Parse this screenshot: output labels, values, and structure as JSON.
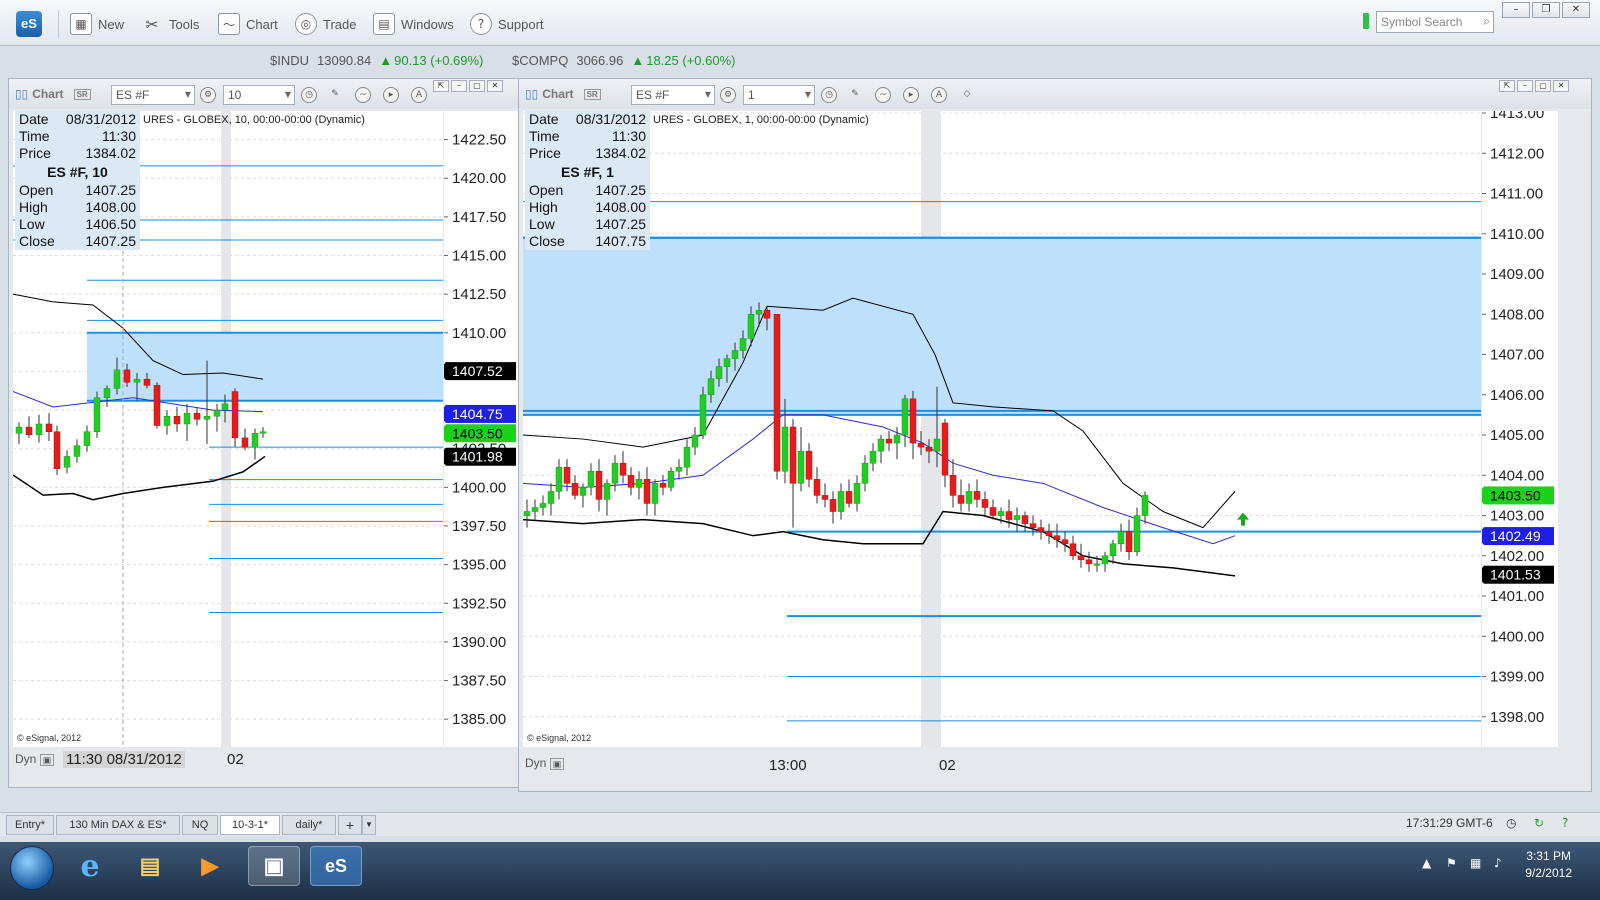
{
  "app": {
    "logo": "eS",
    "toolbar": [
      {
        "label": "New",
        "icon": "new-chart-icon"
      },
      {
        "label": "Tools",
        "icon": "tools-icon"
      },
      {
        "label": "Chart",
        "icon": "chart-icon"
      },
      {
        "label": "Trade",
        "icon": "trade-icon"
      },
      {
        "label": "Windows",
        "icon": "windows-icon"
      },
      {
        "label": "Support",
        "icon": "support-icon"
      }
    ],
    "search_placeholder": "Symbol Search"
  },
  "tickers": [
    {
      "symbol": "$INDU",
      "last": "13090.84",
      "change": "90.13 (+0.69%)"
    },
    {
      "symbol": "$COMPQ",
      "last": "3066.96",
      "change": "18.25 (+0.60%)"
    }
  ],
  "left_chart": {
    "title": "Chart",
    "symbol": "ES #F",
    "interval": "10",
    "legend": "URES - GLOBEX, 10, 00:00-00:00 (Dynamic)",
    "data_window": {
      "date_label": "Date",
      "date": "08/31/2012",
      "time_label": "Time",
      "time": "11:30",
      "price_label": "Price",
      "price": "1384.02",
      "header": "ES #F, 10",
      "open_label": "Open",
      "open": "1407.25",
      "high_label": "High",
      "high": "1408.00",
      "low_label": "Low",
      "low": "1406.50",
      "close_label": "Close",
      "close": "1407.25"
    },
    "axis_ticks": [
      "1422.50",
      "1420.00",
      "1417.50",
      "1415.00",
      "1412.50",
      "1410.00",
      "1407.50",
      "1405.00",
      "1402.50",
      "1400.00",
      "1397.50",
      "1395.00",
      "1392.50",
      "1390.00",
      "1387.50",
      "1385.00"
    ],
    "price_tags": [
      {
        "label": "1407.52",
        "color": "#000000"
      },
      {
        "label": "1404.75",
        "color": "#1e1ee6"
      },
      {
        "label": "1403.50",
        "color": "#19d219"
      },
      {
        "label": "1401.98",
        "color": "#000000"
      }
    ],
    "dyn": "Dyn",
    "cursor_time": "11:30 08/31/2012",
    "time_tick": "02",
    "copyright": "© eSignal, 2012"
  },
  "right_chart": {
    "title": "Chart",
    "symbol": "ES #F",
    "interval": "1",
    "legend": "URES - GLOBEX, 1, 00:00-00:00 (Dynamic)",
    "data_window": {
      "date_label": "Date",
      "date": "08/31/2012",
      "time_label": "Time",
      "time": "11:30",
      "price_label": "Price",
      "price": "1384.02",
      "header": "ES #F, 1",
      "open_label": "Open",
      "open": "1407.25",
      "high_label": "High",
      "high": "1408.00",
      "low_label": "Low",
      "low": "1407.25",
      "close_label": "Close",
      "close": "1407.75"
    },
    "axis_ticks": [
      "1413.00",
      "1412.00",
      "1411.00",
      "1410.00",
      "1409.00",
      "1408.00",
      "1407.00",
      "1406.00",
      "1405.00",
      "1404.00",
      "1403.00",
      "1402.00",
      "1401.00",
      "1400.00",
      "1399.00",
      "1398.00"
    ],
    "price_tags": [
      {
        "label": "1403.50",
        "color": "#19d219"
      },
      {
        "label": "1402.49",
        "color": "#1e1ee6"
      },
      {
        "label": "1401.53",
        "color": "#000000"
      }
    ],
    "dyn": "Dyn",
    "time_ticks": [
      "13:00",
      "02"
    ],
    "copyright": "© eSignal, 2012"
  },
  "page_tabs": [
    {
      "label": "Entry*",
      "active": false
    },
    {
      "label": "130 Min DAX & ES*",
      "active": false
    },
    {
      "label": "NQ",
      "active": false
    },
    {
      "label": "10-3-1*",
      "active": true
    },
    {
      "label": "daily*",
      "active": false
    }
  ],
  "status_time": "17:31:29 GMT-6",
  "taskbar": {
    "time": "3:31 PM",
    "date": "9/2/2012",
    "apps": [
      {
        "name": "internet-explorer-icon",
        "glyph": "e"
      },
      {
        "name": "file-explorer-icon",
        "glyph": "▤"
      },
      {
        "name": "media-player-icon",
        "glyph": "▶"
      },
      {
        "name": "remote-desktop-icon",
        "glyph": "▣"
      },
      {
        "name": "esignal-taskbar-icon",
        "glyph": "eS"
      }
    ]
  },
  "colors": {
    "up_candle": "#22cc22",
    "down_candle": "#e61c1c",
    "zone_fill": "#bfe0fb",
    "level_line": "#1b8ee0",
    "ma_line": "#2c2cd6",
    "band_line": "#000000"
  }
}
